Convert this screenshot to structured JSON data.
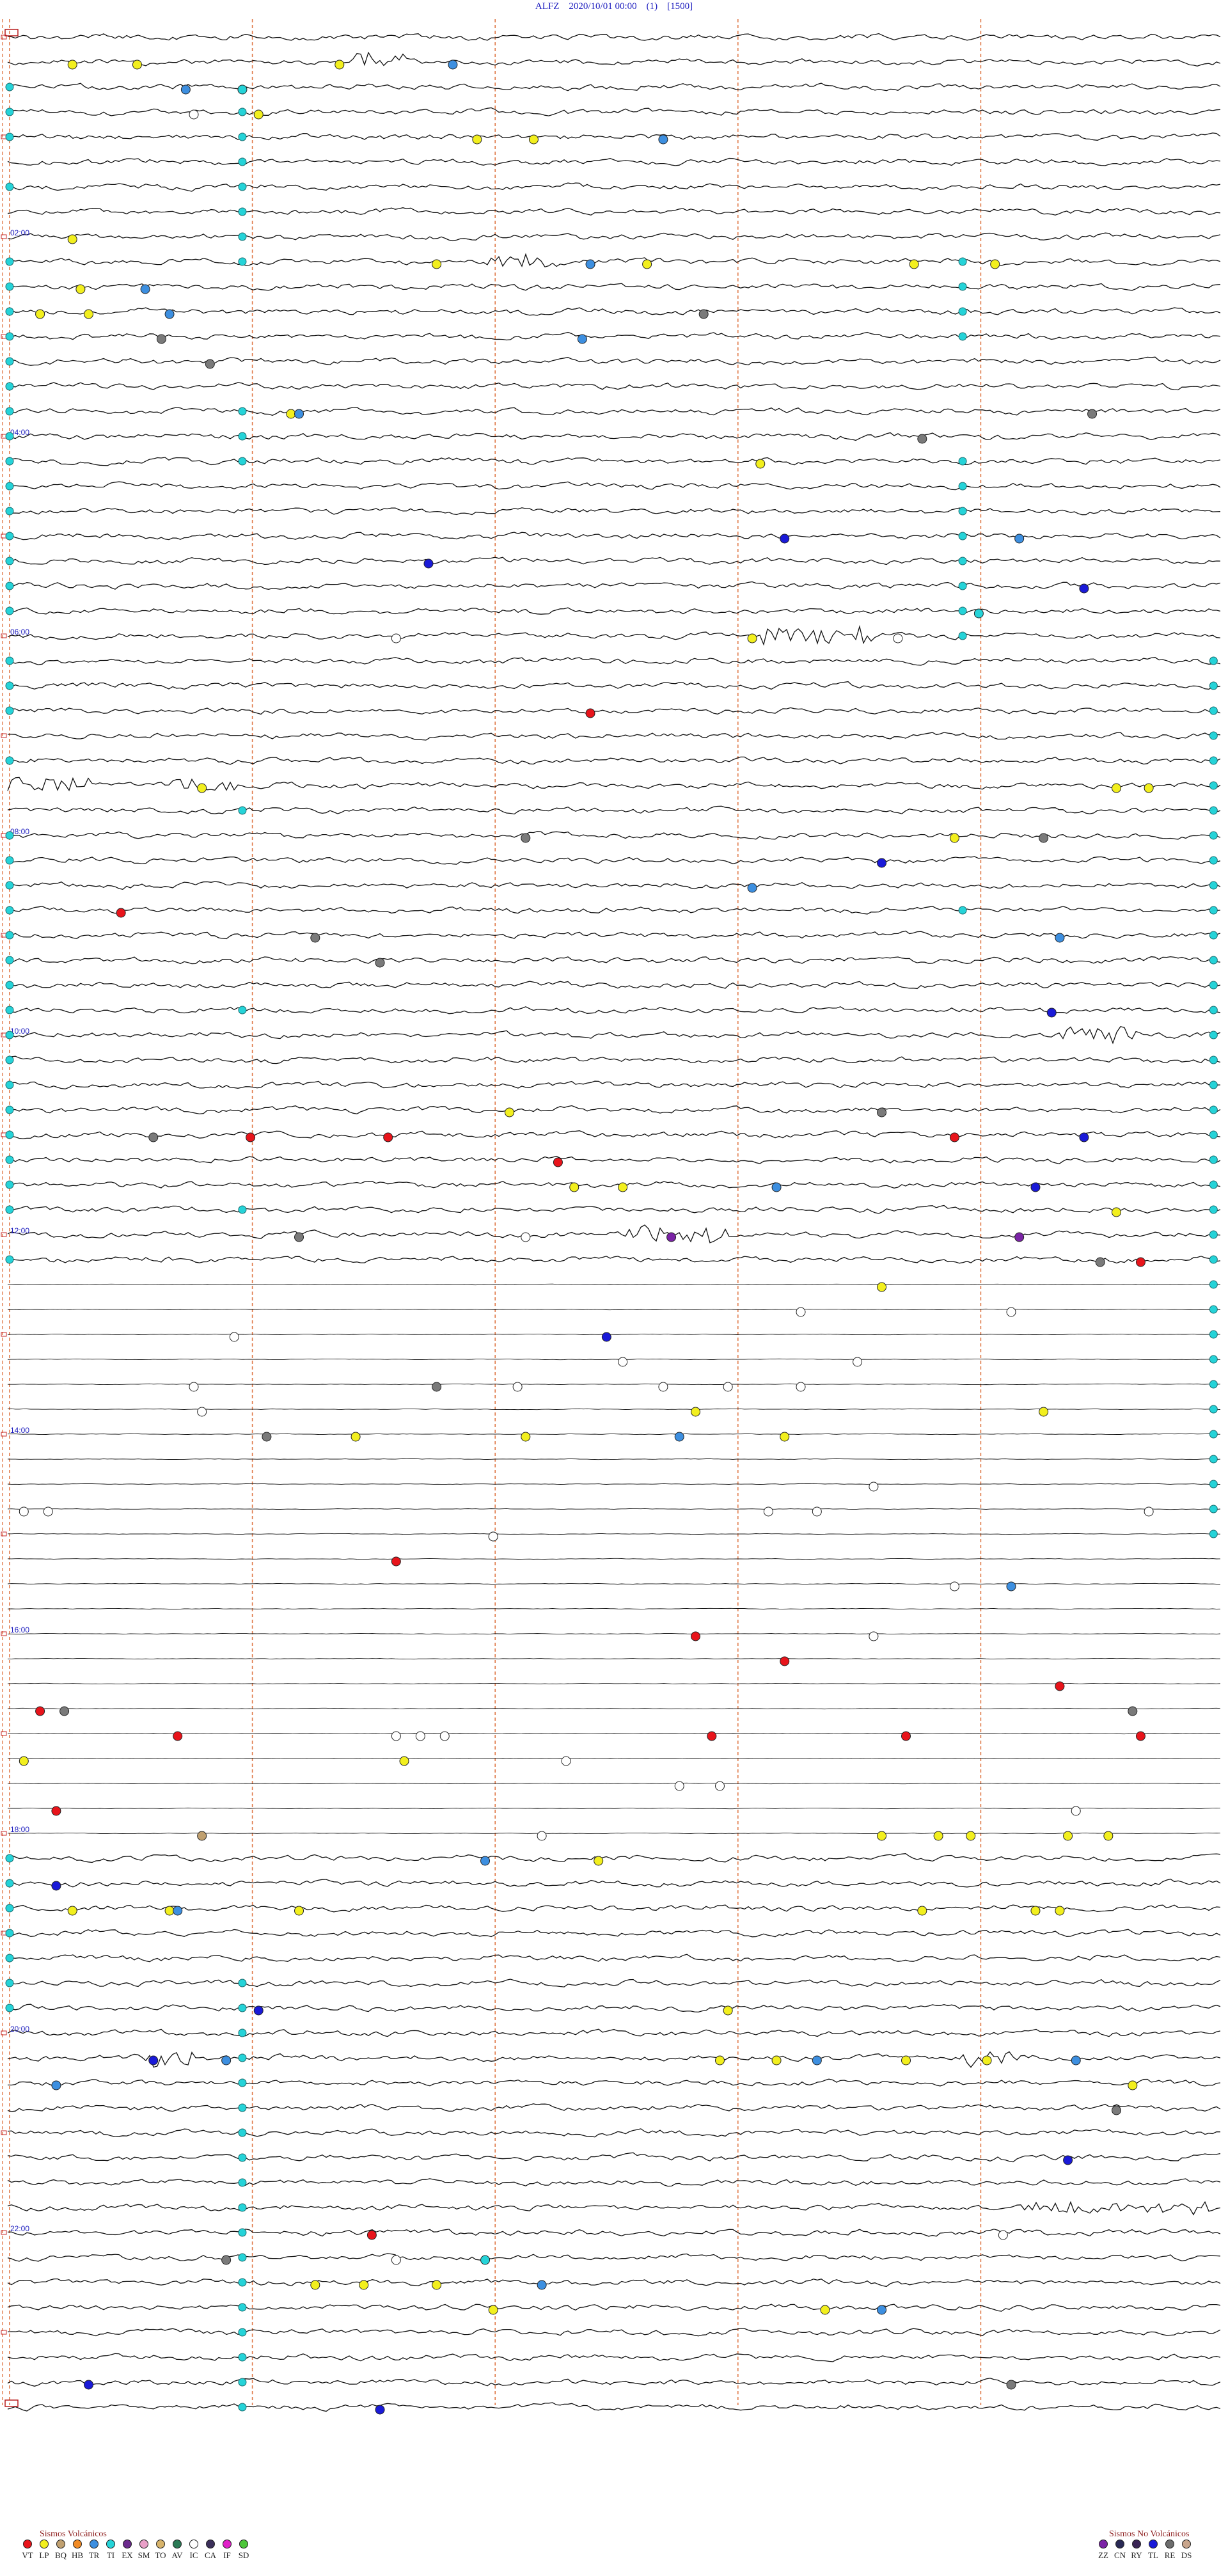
{
  "header": {
    "station": "ALFZ",
    "datetime": "2020/10/01 00:00",
    "channel": "(1)",
    "scale": "[1500]"
  },
  "chart_data": {
    "type": "scatter",
    "title": "ALFZ    2020/10/01 00:00    (1)    [1500]",
    "description_of_axes": "helicorder: each row is one trace-line of 15 min; x = minute within the line (0-15), y = line index from top (0-95)",
    "trace_lines": 96,
    "minutes_per_line": 15,
    "xlim": [
      0,
      15
    ],
    "ylim": [
      0,
      96
    ],
    "hour_labels": [
      "02:00",
      "04:00",
      "06:00",
      "08:00",
      "10:00",
      "12:00",
      "14:00",
      "16:00",
      "18:00",
      "20:00",
      "22:00"
    ],
    "hour_label_lines": [
      8,
      16,
      24,
      32,
      40,
      48,
      56,
      64,
      72,
      80,
      88
    ],
    "flat_trace_lines": [
      50,
      51,
      52,
      53,
      54,
      55,
      56,
      57,
      58,
      59,
      60,
      61,
      62,
      63,
      64,
      65,
      66,
      67,
      68,
      69,
      70,
      71,
      72
    ],
    "bursts": [
      {
        "line": 1,
        "start": 4.2,
        "end": 4.9,
        "amp": 6
      },
      {
        "line": 9,
        "start": 5.9,
        "end": 6.8,
        "amp": 5
      },
      {
        "line": 24,
        "start": 9.3,
        "end": 10.7,
        "amp": 8
      },
      {
        "line": 30,
        "start": 0.0,
        "end": 1.0,
        "amp": 7
      },
      {
        "line": 30,
        "start": 2.0,
        "end": 2.8,
        "amp": 7
      },
      {
        "line": 40,
        "start": 13.0,
        "end": 13.9,
        "amp": 7
      },
      {
        "line": 48,
        "start": 7.6,
        "end": 9.0,
        "amp": 7
      },
      {
        "line": 81,
        "start": 1.7,
        "end": 2.3,
        "amp": 9
      },
      {
        "line": 81,
        "start": 11.8,
        "end": 12.5,
        "amp": 6
      },
      {
        "line": 87,
        "start": 12.5,
        "end": 14.9,
        "amp": 5
      }
    ],
    "events": [
      {
        "line": 1,
        "minute": 0.8,
        "type": "LP"
      },
      {
        "line": 1,
        "minute": 1.6,
        "type": "LP"
      },
      {
        "line": 1,
        "minute": 4.1,
        "type": "LP"
      },
      {
        "line": 1,
        "minute": 5.5,
        "type": "HB"
      },
      {
        "line": 2,
        "minute": 2.2,
        "type": "HB"
      },
      {
        "line": 2,
        "minute": 2.9,
        "type": "TI"
      },
      {
        "line": 3,
        "minute": 3.1,
        "type": "LP"
      },
      {
        "line": 3,
        "minute": 2.3,
        "type": "IC"
      },
      {
        "line": 4,
        "minute": 5.8,
        "type": "LP"
      },
      {
        "line": 4,
        "minute": 6.5,
        "type": "LP"
      },
      {
        "line": 4,
        "minute": 8.1,
        "type": "HB"
      },
      {
        "line": 8,
        "minute": 0.8,
        "type": "LP"
      },
      {
        "line": 9,
        "minute": 5.3,
        "type": "LP"
      },
      {
        "line": 9,
        "minute": 7.2,
        "type": "HB"
      },
      {
        "line": 9,
        "minute": 7.9,
        "type": "LP"
      },
      {
        "line": 9,
        "minute": 11.2,
        "type": "LP"
      },
      {
        "line": 9,
        "minute": 12.2,
        "type": "LP"
      },
      {
        "line": 10,
        "minute": 0.9,
        "type": "LP"
      },
      {
        "line": 10,
        "minute": 1.7,
        "type": "HB"
      },
      {
        "line": 11,
        "minute": 8.6,
        "type": "AV"
      },
      {
        "line": 11,
        "minute": 0.4,
        "type": "LP"
      },
      {
        "line": 11,
        "minute": 1.0,
        "type": "LP"
      },
      {
        "line": 11,
        "minute": 2.0,
        "type": "HB"
      },
      {
        "line": 12,
        "minute": 7.1,
        "type": "HB"
      },
      {
        "line": 12,
        "minute": 1.9,
        "type": "AV"
      },
      {
        "line": 13,
        "minute": 2.5,
        "type": "AV"
      },
      {
        "line": 15,
        "minute": 3.5,
        "type": "LP"
      },
      {
        "line": 15,
        "minute": 3.6,
        "type": "HB"
      },
      {
        "line": 15,
        "minute": 13.4,
        "type": "AV"
      },
      {
        "line": 16,
        "minute": 11.3,
        "type": "AV"
      },
      {
        "line": 17,
        "minute": 9.3,
        "type": "LP"
      },
      {
        "line": 20,
        "minute": 9.6,
        "type": "TL"
      },
      {
        "line": 20,
        "minute": 12.5,
        "type": "HB"
      },
      {
        "line": 21,
        "minute": 5.2,
        "type": "TL"
      },
      {
        "line": 22,
        "minute": 13.3,
        "type": "TL"
      },
      {
        "line": 23,
        "minute": 12.0,
        "type": "TI"
      },
      {
        "line": 24,
        "minute": 9.2,
        "type": "LP"
      },
      {
        "line": 24,
        "minute": 11.0,
        "type": "IC"
      },
      {
        "line": 24,
        "minute": 4.8,
        "type": "IC"
      },
      {
        "line": 27,
        "minute": 7.2,
        "type": "VT"
      },
      {
        "line": 30,
        "minute": 13.7,
        "type": "LP"
      },
      {
        "line": 30,
        "minute": 14.1,
        "type": "LP"
      },
      {
        "line": 30,
        "minute": 2.4,
        "type": "LP"
      },
      {
        "line": 32,
        "minute": 11.7,
        "type": "LP"
      },
      {
        "line": 32,
        "minute": 12.8,
        "type": "AV"
      },
      {
        "line": 32,
        "minute": 6.4,
        "type": "AV"
      },
      {
        "line": 33,
        "minute": 10.8,
        "type": "TL"
      },
      {
        "line": 34,
        "minute": 9.2,
        "type": "HB"
      },
      {
        "line": 35,
        "minute": 1.4,
        "type": "VT"
      },
      {
        "line": 36,
        "minute": 3.8,
        "type": "AV"
      },
      {
        "line": 36,
        "minute": 13.0,
        "type": "HB"
      },
      {
        "line": 37,
        "minute": 4.6,
        "type": "AV"
      },
      {
        "line": 39,
        "minute": 12.9,
        "type": "TL"
      },
      {
        "line": 43,
        "minute": 6.2,
        "type": "LP"
      },
      {
        "line": 43,
        "minute": 10.8,
        "type": "AV"
      },
      {
        "line": 44,
        "minute": 1.8,
        "type": "AV"
      },
      {
        "line": 44,
        "minute": 3.0,
        "type": "VT"
      },
      {
        "line": 44,
        "minute": 4.7,
        "type": "VT"
      },
      {
        "line": 44,
        "minute": 11.7,
        "type": "VT"
      },
      {
        "line": 44,
        "minute": 13.3,
        "type": "TL"
      },
      {
        "line": 45,
        "minute": 6.8,
        "type": "VT"
      },
      {
        "line": 46,
        "minute": 7.0,
        "type": "LP"
      },
      {
        "line": 46,
        "minute": 7.6,
        "type": "LP"
      },
      {
        "line": 46,
        "minute": 9.5,
        "type": "HB"
      },
      {
        "line": 46,
        "minute": 12.7,
        "type": "TL"
      },
      {
        "line": 47,
        "minute": 13.7,
        "type": "LP"
      },
      {
        "line": 48,
        "minute": 8.2,
        "type": "ZZ"
      },
      {
        "line": 48,
        "minute": 12.5,
        "type": "ZZ"
      },
      {
        "line": 48,
        "minute": 3.6,
        "type": "AV"
      },
      {
        "line": 48,
        "minute": 6.4,
        "type": "IC"
      },
      {
        "line": 49,
        "minute": 14.0,
        "type": "VT"
      },
      {
        "line": 49,
        "minute": 13.5,
        "type": "AV"
      },
      {
        "line": 50,
        "minute": 10.8,
        "type": "LP"
      },
      {
        "line": 51,
        "minute": 9.8,
        "type": "IC"
      },
      {
        "line": 51,
        "minute": 12.4,
        "type": "IC"
      },
      {
        "line": 52,
        "minute": 2.8,
        "type": "IC"
      },
      {
        "line": 52,
        "minute": 7.4,
        "type": "TL"
      },
      {
        "line": 53,
        "minute": 7.6,
        "type": "IC"
      },
      {
        "line": 53,
        "minute": 10.5,
        "type": "IC"
      },
      {
        "line": 54,
        "minute": 8.1,
        "type": "IC"
      },
      {
        "line": 54,
        "minute": 8.9,
        "type": "IC"
      },
      {
        "line": 54,
        "minute": 2.3,
        "type": "IC"
      },
      {
        "line": 54,
        "minute": 6.3,
        "type": "IC"
      },
      {
        "line": 54,
        "minute": 9.8,
        "type": "IC"
      },
      {
        "line": 54,
        "minute": 5.3,
        "type": "AV"
      },
      {
        "line": 55,
        "minute": 2.4,
        "type": "IC"
      },
      {
        "line": 55,
        "minute": 8.5,
        "type": "LP"
      },
      {
        "line": 55,
        "minute": 12.8,
        "type": "LP"
      },
      {
        "line": 56,
        "minute": 3.2,
        "type": "AV"
      },
      {
        "line": 56,
        "minute": 4.3,
        "type": "LP"
      },
      {
        "line": 56,
        "minute": 6.4,
        "type": "LP"
      },
      {
        "line": 56,
        "minute": 8.3,
        "type": "HB"
      },
      {
        "line": 56,
        "minute": 9.6,
        "type": "LP"
      },
      {
        "line": 58,
        "minute": 10.7,
        "type": "IC"
      },
      {
        "line": 59,
        "minute": 0.2,
        "type": "IC"
      },
      {
        "line": 59,
        "minute": 0.5,
        "type": "IC"
      },
      {
        "line": 59,
        "minute": 9.4,
        "type": "IC"
      },
      {
        "line": 59,
        "minute": 10.0,
        "type": "IC"
      },
      {
        "line": 59,
        "minute": 14.1,
        "type": "IC"
      },
      {
        "line": 60,
        "minute": 6.0,
        "type": "TL"
      },
      {
        "line": 60,
        "minute": 6.0,
        "type": "IC"
      },
      {
        "line": 61,
        "minute": 4.8,
        "type": "VT"
      },
      {
        "line": 62,
        "minute": 11.7,
        "type": "IC"
      },
      {
        "line": 62,
        "minute": 12.4,
        "type": "HB"
      },
      {
        "line": 64,
        "minute": 10.7,
        "type": "IC"
      },
      {
        "line": 64,
        "minute": 8.5,
        "type": "VT"
      },
      {
        "line": 65,
        "minute": 9.6,
        "type": "VT"
      },
      {
        "line": 66,
        "minute": 13.0,
        "type": "VT"
      },
      {
        "line": 67,
        "minute": 13.9,
        "type": "AV"
      },
      {
        "line": 67,
        "minute": 0.4,
        "type": "VT"
      },
      {
        "line": 67,
        "minute": 0.7,
        "type": "AV"
      },
      {
        "line": 68,
        "minute": 2.1,
        "type": "VT"
      },
      {
        "line": 68,
        "minute": 4.8,
        "type": "IC"
      },
      {
        "line": 68,
        "minute": 5.1,
        "type": "IC"
      },
      {
        "line": 68,
        "minute": 5.4,
        "type": "IC"
      },
      {
        "line": 68,
        "minute": 8.7,
        "type": "VT"
      },
      {
        "line": 68,
        "minute": 11.1,
        "type": "VT"
      },
      {
        "line": 68,
        "minute": 14.0,
        "type": "VT"
      },
      {
        "line": 69,
        "minute": 4.9,
        "type": "LP"
      },
      {
        "line": 69,
        "minute": 6.9,
        "type": "IC"
      },
      {
        "line": 69,
        "minute": 0.2,
        "type": "LP"
      },
      {
        "line": 70,
        "minute": 8.3,
        "type": "IC"
      },
      {
        "line": 70,
        "minute": 8.8,
        "type": "IC"
      },
      {
        "line": 71,
        "minute": 13.2,
        "type": "IC"
      },
      {
        "line": 71,
        "minute": 0.6,
        "type": "VT"
      },
      {
        "line": 72,
        "minute": 2.4,
        "type": "BQ"
      },
      {
        "line": 72,
        "minute": 6.6,
        "type": "IC"
      },
      {
        "line": 72,
        "minute": 10.8,
        "type": "LP"
      },
      {
        "line": 72,
        "minute": 11.5,
        "type": "LP"
      },
      {
        "line": 72,
        "minute": 11.9,
        "type": "LP"
      },
      {
        "line": 72,
        "minute": 13.1,
        "type": "LP"
      },
      {
        "line": 72,
        "minute": 13.6,
        "type": "LP"
      },
      {
        "line": 73,
        "minute": 5.9,
        "type": "HB"
      },
      {
        "line": 73,
        "minute": 7.3,
        "type": "LP"
      },
      {
        "line": 74,
        "minute": 0.6,
        "type": "TL"
      },
      {
        "line": 75,
        "minute": 0.8,
        "type": "LP"
      },
      {
        "line": 75,
        "minute": 2.0,
        "type": "LP"
      },
      {
        "line": 75,
        "minute": 2.1,
        "type": "HB"
      },
      {
        "line": 75,
        "minute": 3.6,
        "type": "LP"
      },
      {
        "line": 75,
        "minute": 11.3,
        "type": "LP"
      },
      {
        "line": 75,
        "minute": 12.7,
        "type": "LP"
      },
      {
        "line": 75,
        "minute": 13.0,
        "type": "LP"
      },
      {
        "line": 79,
        "minute": 3.1,
        "type": "TL"
      },
      {
        "line": 79,
        "minute": 8.9,
        "type": "LP"
      },
      {
        "line": 81,
        "minute": 1.8,
        "type": "TL"
      },
      {
        "line": 81,
        "minute": 2.7,
        "type": "HB"
      },
      {
        "line": 81,
        "minute": 8.8,
        "type": "LP"
      },
      {
        "line": 81,
        "minute": 9.5,
        "type": "LP"
      },
      {
        "line": 81,
        "minute": 10.0,
        "type": "HB"
      },
      {
        "line": 81,
        "minute": 11.1,
        "type": "LP"
      },
      {
        "line": 81,
        "minute": 12.1,
        "type": "LP"
      },
      {
        "line": 81,
        "minute": 13.2,
        "type": "HB"
      },
      {
        "line": 82,
        "minute": 0.6,
        "type": "HB"
      },
      {
        "line": 82,
        "minute": 13.9,
        "type": "LP"
      },
      {
        "line": 83,
        "minute": 13.7,
        "type": "AV"
      },
      {
        "line": 85,
        "minute": 13.1,
        "type": "TL"
      },
      {
        "line": 88,
        "minute": 4.5,
        "type": "VT"
      },
      {
        "line": 88,
        "minute": 12.3,
        "type": "IC"
      },
      {
        "line": 89,
        "minute": 2.7,
        "type": "AV"
      },
      {
        "line": 89,
        "minute": 4.8,
        "type": "IC"
      },
      {
        "line": 89,
        "minute": 5.9,
        "type": "TI"
      },
      {
        "line": 90,
        "minute": 3.8,
        "type": "LP"
      },
      {
        "line": 90,
        "minute": 4.4,
        "type": "LP"
      },
      {
        "line": 90,
        "minute": 5.3,
        "type": "LP"
      },
      {
        "line": 90,
        "minute": 6.6,
        "type": "HB"
      },
      {
        "line": 91,
        "minute": 6.0,
        "type": "LP"
      },
      {
        "line": 91,
        "minute": 10.1,
        "type": "LP"
      },
      {
        "line": 91,
        "minute": 10.8,
        "type": "HB"
      },
      {
        "line": 94,
        "minute": 1.0,
        "type": "TL"
      },
      {
        "line": 94,
        "minute": 12.4,
        "type": "AV"
      },
      {
        "line": 95,
        "minute": 4.6,
        "type": "TL"
      }
    ],
    "ti_markers": [
      {
        "minute": 0.0,
        "lines": [
          2,
          3,
          4,
          6,
          9,
          10,
          11,
          12,
          13,
          14,
          15,
          16,
          17,
          18,
          19,
          20,
          21,
          22,
          23,
          25,
          26,
          27,
          29,
          32,
          33,
          34,
          35,
          36,
          37,
          38,
          39,
          40,
          41,
          42,
          43,
          44,
          45,
          46,
          47,
          49,
          73,
          74,
          75,
          76,
          77,
          78,
          79
        ]
      },
      {
        "minute": 2.9,
        "lines": [
          3,
          4,
          5,
          6,
          7,
          8,
          9,
          15,
          16,
          17,
          31,
          39,
          47,
          78,
          79,
          80,
          81,
          82,
          83,
          84,
          85,
          86,
          87,
          88,
          89,
          90,
          91,
          92,
          93,
          94,
          95
        ]
      },
      {
        "minute": 11.8,
        "lines": [
          9,
          10,
          11,
          12,
          17,
          18,
          19,
          20,
          21,
          22,
          23,
          24,
          35
        ]
      },
      {
        "minute": 14.9,
        "lines": [
          25,
          26,
          27,
          28,
          29,
          30,
          31,
          32,
          33,
          34,
          35,
          36,
          37,
          38,
          39,
          40,
          41,
          42,
          43,
          44,
          45,
          46,
          47,
          48,
          49,
          50,
          51,
          52,
          53,
          54,
          55,
          56,
          57,
          58,
          59,
          60
        ]
      }
    ]
  },
  "legend": {
    "volcanic_title": "Sismos Volcánicos",
    "non_volcanic_title": "Sismos No Volcánicos",
    "volcanic": [
      {
        "code": "VT",
        "color": "#e8141b"
      },
      {
        "code": "LP",
        "color": "#f2ef1e"
      },
      {
        "code": "BQ",
        "color": "#c0a070"
      },
      {
        "code": "HB",
        "color": "#f08a24"
      },
      {
        "code": "TR",
        "color": "#3d8fe0"
      },
      {
        "code": "TI",
        "color": "#25d3d8"
      },
      {
        "code": "EX",
        "color": "#6b2a8c"
      },
      {
        "code": "SM",
        "color": "#e9a0c8"
      },
      {
        "code": "TO",
        "color": "#d7b36a"
      },
      {
        "code": "AV",
        "color": "#2b7a55"
      },
      {
        "code": "IC",
        "color": "#ffffff"
      },
      {
        "code": "CA",
        "color": "#3b2f5a"
      },
      {
        "code": "IF",
        "color": "#e021c8"
      },
      {
        "code": "SD",
        "color": "#4ec63a"
      }
    ],
    "non_volcanic": [
      {
        "code": "ZZ",
        "color": "#7b23a6"
      },
      {
        "code": "CN",
        "color": "#2a2a55"
      },
      {
        "code": "RY",
        "color": "#3a2454"
      },
      {
        "code": "TL",
        "color": "#1a1ad8"
      },
      {
        "code": "RE",
        "color": "#6d6d6d"
      },
      {
        "code": "DS",
        "color": "#c8a58c"
      }
    ]
  },
  "event_styles": {
    "VT": "#e8141b",
    "LP": "#f2ef1e",
    "BQ": "#c0a070",
    "HB": "#3d8fe0",
    "TI": "#25d3d8",
    "AV": "#7a7a7a",
    "IC": "#ffffff",
    "TL": "#1a1ad8",
    "ZZ": "#7b23a6"
  }
}
